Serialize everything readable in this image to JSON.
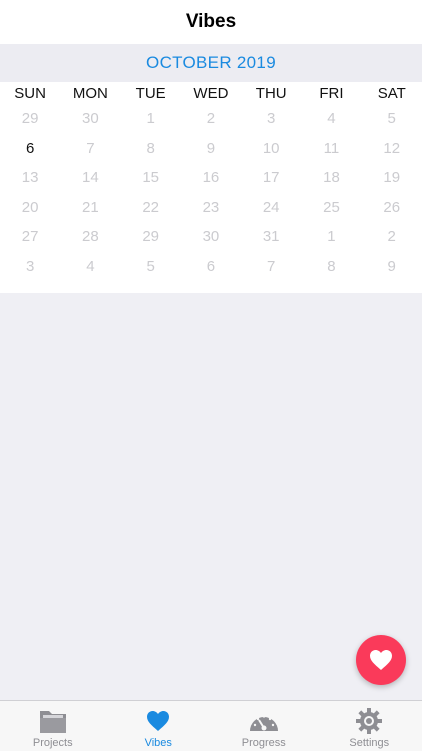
{
  "header": {
    "title": "Vibes"
  },
  "calendar": {
    "month_label": "OCTOBER 2019",
    "weekdays": [
      "SUN",
      "MON",
      "TUE",
      "WED",
      "THU",
      "FRI",
      "SAT"
    ],
    "weeks": [
      [
        "29",
        "30",
        "1",
        "2",
        "3",
        "4",
        "5"
      ],
      [
        "6",
        "7",
        "8",
        "9",
        "10",
        "11",
        "12"
      ],
      [
        "13",
        "14",
        "15",
        "16",
        "17",
        "18",
        "19"
      ],
      [
        "20",
        "21",
        "22",
        "23",
        "24",
        "25",
        "26"
      ],
      [
        "27",
        "28",
        "29",
        "30",
        "31",
        "1",
        "2"
      ],
      [
        "3",
        "4",
        "5",
        "6",
        "7",
        "8",
        "9"
      ]
    ],
    "active_day": "6"
  },
  "fab": {
    "icon": "heart-icon",
    "color": "#fa3a5a"
  },
  "tabbar": {
    "tabs": [
      {
        "label": "Projects",
        "icon": "folder-icon",
        "selected": false
      },
      {
        "label": "Vibes",
        "icon": "heart-icon",
        "selected": true
      },
      {
        "label": "Progress",
        "icon": "gauge-icon",
        "selected": false
      },
      {
        "label": "Settings",
        "icon": "gear-icon",
        "selected": false
      }
    ]
  },
  "colors": {
    "accent": "#1a8ae0",
    "background": "#efeff4",
    "inactive": "#8e8e93"
  }
}
